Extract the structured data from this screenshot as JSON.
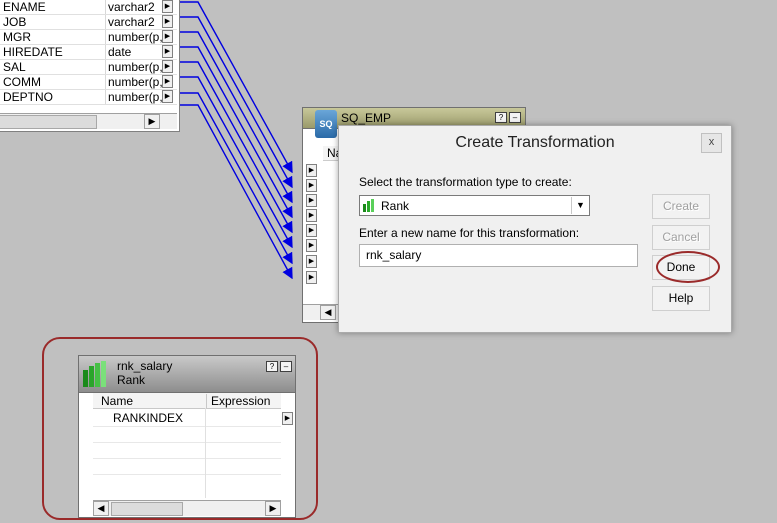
{
  "source_table": {
    "rows": [
      {
        "name": "ENAME",
        "type": "varchar2"
      },
      {
        "name": "JOB",
        "type": "varchar2"
      },
      {
        "name": "MGR",
        "type": "number(p,s)"
      },
      {
        "name": "HIREDATE",
        "type": "date"
      },
      {
        "name": "SAL",
        "type": "number(p,s)"
      },
      {
        "name": "COMM",
        "type": "number(p,s)"
      },
      {
        "name": "DEPTNO",
        "type": "number(p,s)"
      }
    ]
  },
  "sq_emp": {
    "title": "SQ_EMP",
    "column_header": "Na",
    "icon_text": "SQ"
  },
  "dialog": {
    "title": "Create Transformation",
    "close": "x",
    "type_label": "Select the transformation type to create:",
    "selected_type": "Rank",
    "name_label": "Enter a new name for this transformation:",
    "name_value": "rnk_salary",
    "buttons": {
      "create": "Create",
      "cancel": "Cancel",
      "done": "Done",
      "help": "Help"
    }
  },
  "rank_box": {
    "name": "rnk_salary",
    "type": "Rank",
    "columns": [
      "Name",
      "Expression"
    ],
    "rows": [
      "RANKINDEX"
    ]
  },
  "colors": {
    "link_blue": "#0000e0",
    "highlight_ring": "#9a2a2a",
    "workspace": "#c0c0c0"
  }
}
